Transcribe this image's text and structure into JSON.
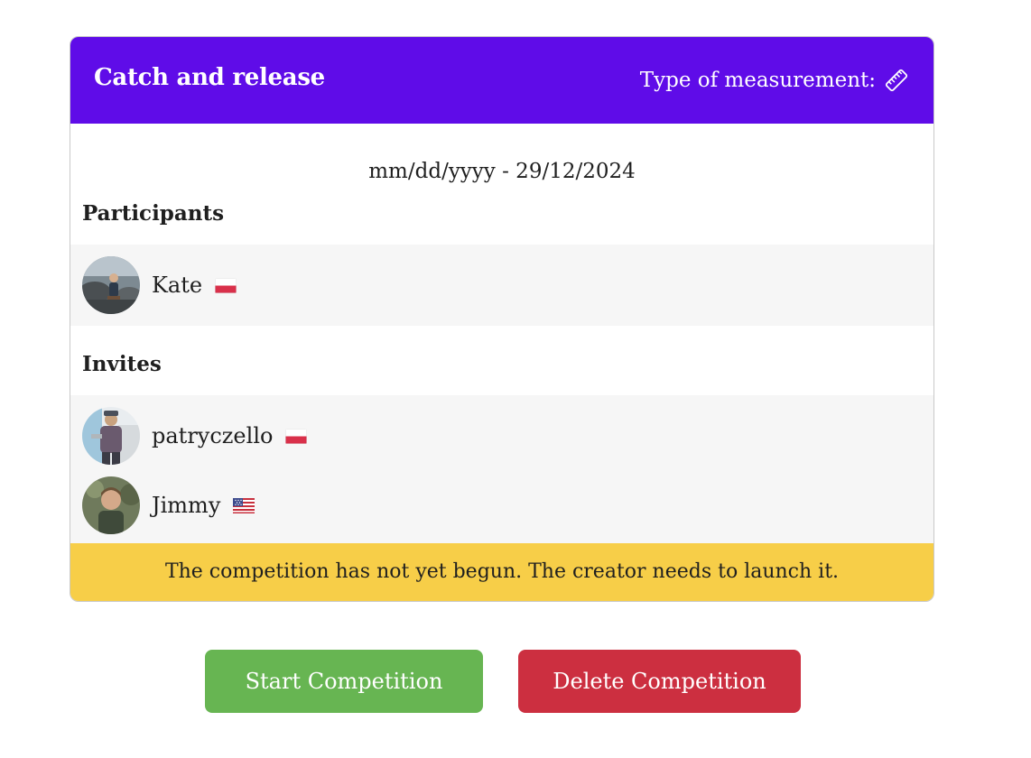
{
  "competition": {
    "title": "Catch and release",
    "measurement_label": "Type of measurement:",
    "measurement_icon": "ruler-icon",
    "date_range": "mm/dd/yyyy - 29/12/2024"
  },
  "participants": {
    "title": "Participants",
    "items": [
      {
        "name": "Kate",
        "flag": "poland-flag-icon"
      }
    ]
  },
  "invites": {
    "title": "Invites",
    "items": [
      {
        "name": "patryczello",
        "flag": "poland-flag-icon"
      },
      {
        "name": "Jimmy",
        "flag": "usa-flag-icon"
      }
    ]
  },
  "status": {
    "message": "The competition has not yet begun. The creator needs to launch it.",
    "color": "#f7ce48"
  },
  "actions": {
    "start_label": "Start Competition",
    "delete_label": "Delete Competition"
  },
  "colors": {
    "header": "#5f0ce8",
    "start": "#67b552",
    "delete": "#cc2f40"
  }
}
